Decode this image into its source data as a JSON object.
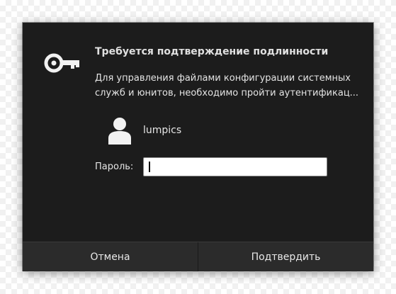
{
  "dialog": {
    "title": "Требуется подтверждение подлинности",
    "message": "Для управления файлами конфигурации системных служб и юнитов, необходимо пройти аутентификац...",
    "icon": "key-icon"
  },
  "user": {
    "avatar_icon": "user-avatar-icon",
    "name": "lumpics"
  },
  "password": {
    "label": "Пароль:",
    "value": ""
  },
  "buttons": {
    "cancel_label": "Отмена",
    "confirm_label": "Подтвердить"
  },
  "colors": {
    "dialog_bg": "#1c1c1c",
    "button_bar_bg": "#2b2b2b",
    "text": "#e8e8e8",
    "field_bg": "#ffffff"
  }
}
